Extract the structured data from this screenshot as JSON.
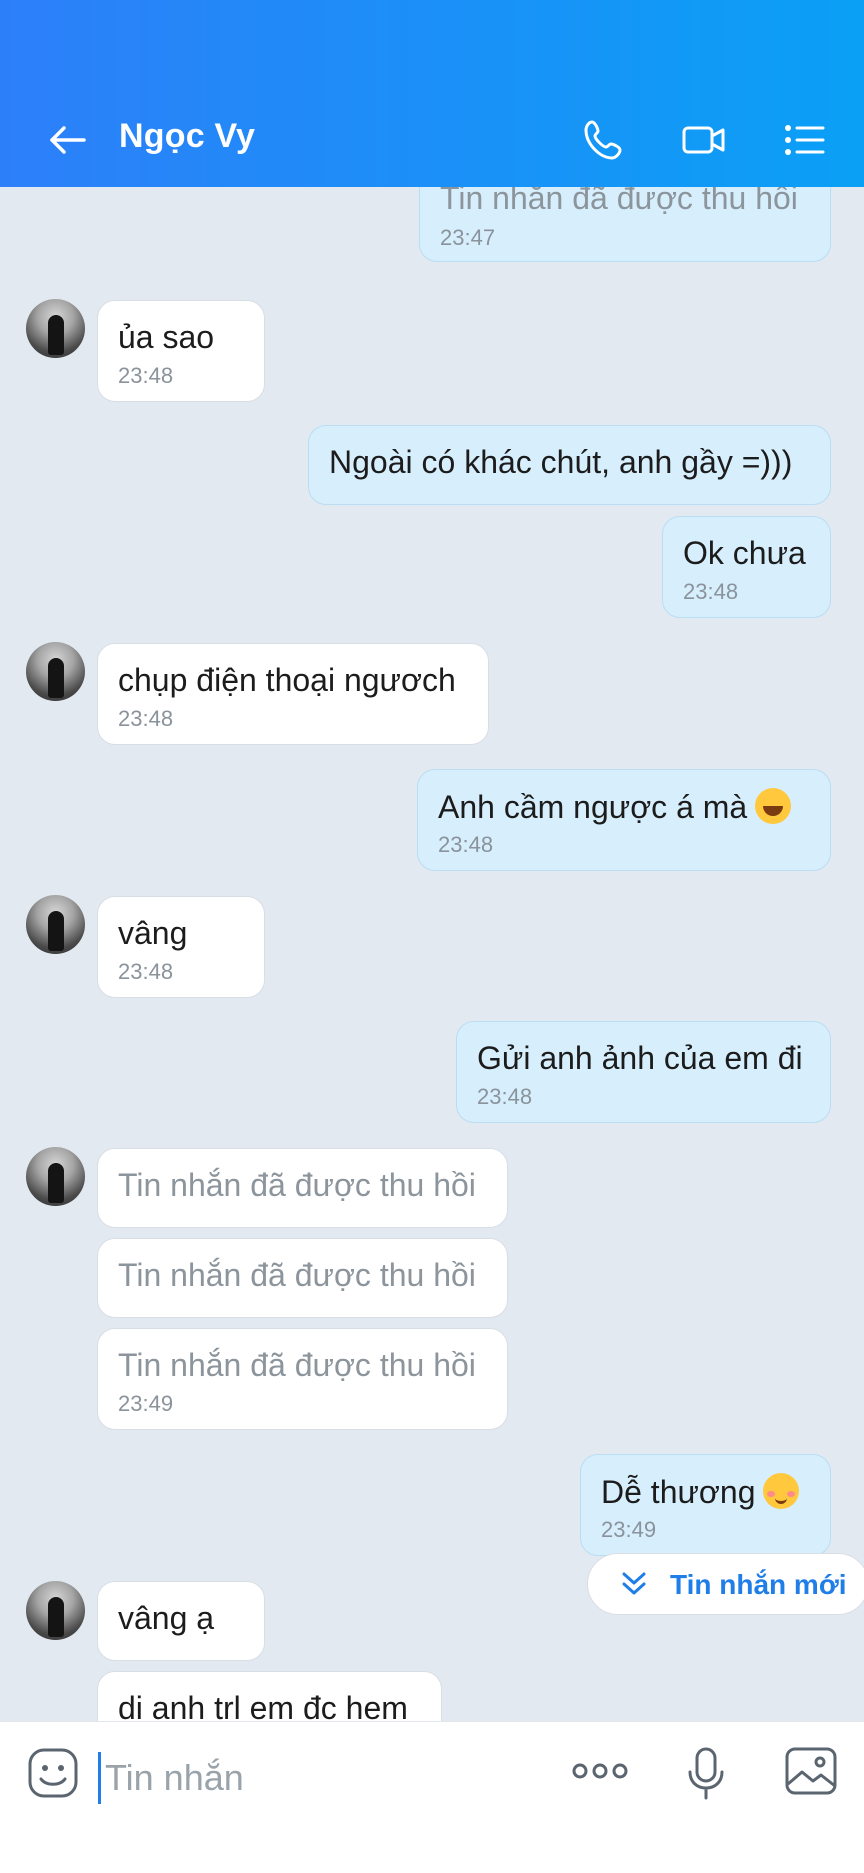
{
  "header": {
    "title": "Ngọc Vy"
  },
  "messages": [
    {
      "side": "out",
      "text": "Tin nhắn đã được thu hồi",
      "time": "23:47",
      "recalled": true
    },
    {
      "side": "in",
      "text": "ủa sao",
      "time": "23:48"
    },
    {
      "side": "out",
      "text": "Ngoài có khác chút, anh gầy =)))",
      "time": ""
    },
    {
      "side": "out",
      "text": "Ok chưa",
      "time": "23:48"
    },
    {
      "side": "in",
      "text": "chụp điện thoại ngươch",
      "time": "23:48"
    },
    {
      "side": "out",
      "text": "Anh cầm ngược á mà",
      "time": "23:48",
      "emoji": "laughing-emoji"
    },
    {
      "side": "in",
      "text": "vâng",
      "time": "23:48"
    },
    {
      "side": "out",
      "text": "Gửi anh ảnh của em đi",
      "time": "23:48"
    },
    {
      "side": "in",
      "text": "Tin nhắn đã được thu hồi",
      "time": "",
      "recalled": true
    },
    {
      "side": "in",
      "text": "Tin nhắn đã được thu hồi",
      "time": "",
      "recalled": true
    },
    {
      "side": "in",
      "text": "Tin nhắn đã được thu hồi",
      "time": "23:49",
      "recalled": true
    },
    {
      "side": "out",
      "text": "Dễ thương",
      "time": "23:49",
      "emoji": "blushing-emoji"
    },
    {
      "side": "in",
      "text": "vâng ạ",
      "time": ""
    },
    {
      "side": "in",
      "text": "di anh trl em đc hem",
      "time": ""
    }
  ],
  "new_message_button": {
    "label": "Tin nhắn mới"
  },
  "composer": {
    "placeholder": "Tin nhắn"
  },
  "icons": {
    "back": "arrow-left-icon",
    "call": "phone-icon",
    "video": "video-camera-icon",
    "menu": "list-menu-icon",
    "sticker": "sticker-icon",
    "more": "more-dots-icon",
    "mic": "microphone-icon",
    "image": "image-icon"
  },
  "colors": {
    "header_start": "#2d7ff9",
    "header_end": "#0aa0f6",
    "accent": "#1f7ee8"
  }
}
